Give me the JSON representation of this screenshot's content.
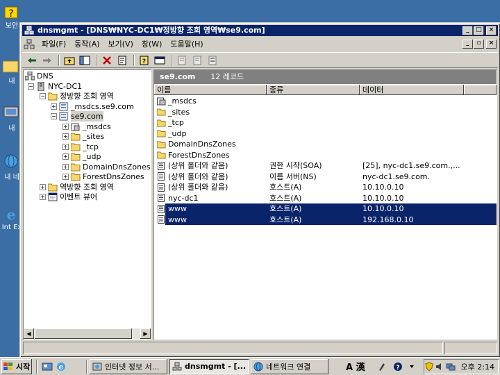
{
  "desktop": {
    "icons": [
      "보안",
      "내",
      "내 ",
      "내 네",
      "Int Ex"
    ]
  },
  "window": {
    "title": "dnsmgmt - [DNS₩NYC-DC1₩정방향 조회 영역₩se9.com]",
    "menu": [
      "파일(F)",
      "동작(A)",
      "보기(V)",
      "창(W)",
      "도움말(H)"
    ]
  },
  "tree": {
    "root": "DNS",
    "server": "NYC-DC1",
    "forward_zone": "정방향 조회 영역",
    "msdcs_zone": "_msdcs.se9.com",
    "zone": "se9.com",
    "children": [
      "_msdcs",
      "_sites",
      "_tcp",
      "_udp",
      "DomainDnsZones",
      "ForestDnsZones"
    ],
    "reverse_zone": "역방향 조회 영역",
    "event_viewer": "이벤트 뷰어"
  },
  "list": {
    "header_title": "se9.com",
    "header_count": "12 레코드",
    "columns": [
      "이름",
      "종류",
      "데이터"
    ],
    "rows": [
      {
        "name": "_msdcs",
        "type": "",
        "data": "",
        "icon": "delegated-folder-icon",
        "hl": false
      },
      {
        "name": "_sites",
        "type": "",
        "data": "",
        "icon": "folder-icon",
        "hl": false
      },
      {
        "name": "_tcp",
        "type": "",
        "data": "",
        "icon": "folder-icon",
        "hl": false
      },
      {
        "name": "_udp",
        "type": "",
        "data": "",
        "icon": "folder-icon",
        "hl": false
      },
      {
        "name": "DomainDnsZones",
        "type": "",
        "data": "",
        "icon": "folder-icon",
        "hl": false
      },
      {
        "name": "ForestDnsZones",
        "type": "",
        "data": "",
        "icon": "folder-icon",
        "hl": false
      },
      {
        "name": "(상위 폴더와 같음)",
        "type": "권한 시작(SOA)",
        "data": "[25], nyc-dc1.se9.com.,...",
        "icon": "record-icon",
        "hl": false
      },
      {
        "name": "(상위 폴더와 같음)",
        "type": "이름 서버(NS)",
        "data": "nyc-dc1.se9.com.",
        "icon": "record-icon",
        "hl": false
      },
      {
        "name": "(상위 폴더와 같음)",
        "type": "호스트(A)",
        "data": "10.10.0.10",
        "icon": "record-icon",
        "hl": false
      },
      {
        "name": "nyc-dc1",
        "type": "호스트(A)",
        "data": "10.10.0.10",
        "icon": "record-icon",
        "hl": false
      },
      {
        "name": "www",
        "type": "호스트(A)",
        "data": "10.10.0.10",
        "icon": "record-icon",
        "hl": true
      },
      {
        "name": "www",
        "type": "호스트(A)",
        "data": "192.168.0.10",
        "icon": "record-icon",
        "hl": true
      }
    ]
  },
  "taskbar": {
    "start": "시작",
    "tasks": [
      "인터넷 정보 서...",
      "dnsmgmt - [...",
      "네트워크 연결"
    ],
    "ime": "A 漢",
    "clock": "오후 2:14"
  },
  "colors": {
    "desktop": "#3a6ea5",
    "titlebar": "#0a246a",
    "selection": "#0a246a",
    "face": "#d4d0c8"
  }
}
